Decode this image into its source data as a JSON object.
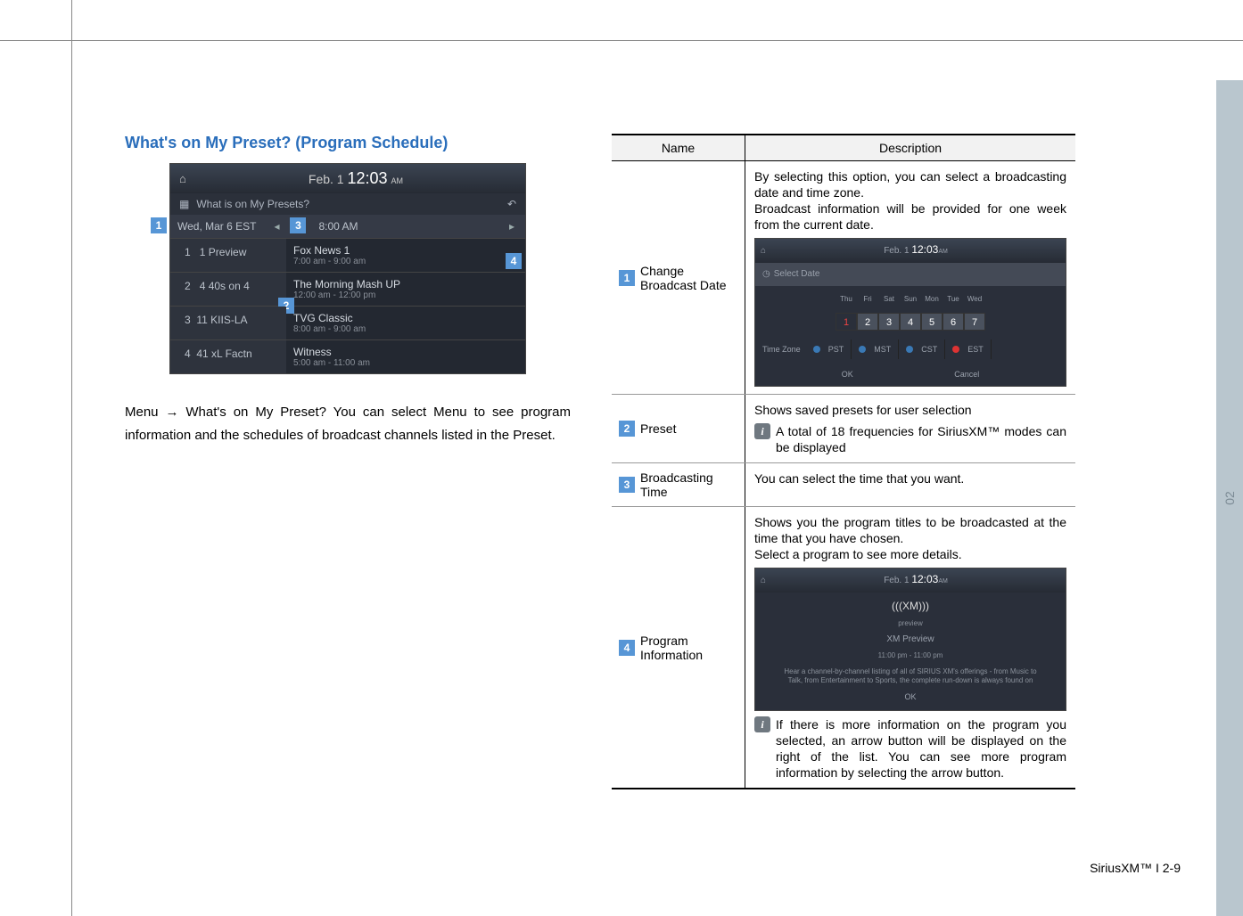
{
  "section_title": "What's on My Preset? (Program Schedule)",
  "main_screenshot": {
    "date_prefix": "Feb.  1",
    "time": "12:03",
    "ampm": "AM",
    "subtitle": "What is on My Presets?",
    "nav_day": "Wed, Mar 6 EST",
    "nav_time": "8:00 AM",
    "rows": [
      {
        "idx": "1",
        "ch": "1 Preview",
        "title": "Fox News 1",
        "slot": "7:00 am - 9:00 am"
      },
      {
        "idx": "2",
        "ch": "4 40s on 4",
        "title": "The Morning Mash UP",
        "slot": "12:00 am - 12:00 pm"
      },
      {
        "idx": "3",
        "ch": "11 KIIS-LA",
        "title": "TVG Classic",
        "slot": "8:00 am - 9:00 am"
      },
      {
        "idx": "4",
        "ch": "41 xL Factn",
        "title": "Witness",
        "slot": "5:00 am - 11:00 am"
      }
    ]
  },
  "body_text_pre": "Menu ",
  "body_text_post": " What's on My Preset? You can select Menu to see pro­gram information and the schedules of broadcast channels listed in the Preset.",
  "table": {
    "headers": {
      "name": "Name",
      "desc": "Description"
    },
    "rows": [
      {
        "num": "1",
        "name": "Change Broadcast Date",
        "desc": "By selecting this option, you can select a broad­casting date and time zone.\nBroadcast information will be provided for one week from the current date.",
        "inner": {
          "date": "Feb.  1",
          "time": "12:03",
          "ampm": "AM",
          "select": "Select Date",
          "days": [
            "Thu",
            "Fri",
            "Sat",
            "Sun",
            "Mon",
            "Tue",
            "Wed"
          ],
          "nums": [
            "1",
            "2",
            "3",
            "4",
            "5",
            "6",
            "7"
          ],
          "tz_label": "Time Zone",
          "tz_opts": [
            "PST",
            "MST",
            "CST",
            "EST"
          ],
          "ok": "OK",
          "cancel": "Cancel"
        }
      },
      {
        "num": "2",
        "name": "Preset",
        "desc": "Shows saved presets for user selection",
        "info_note": "A total of 18 frequencies for SiriusXM™ modes can be displayed"
      },
      {
        "num": "3",
        "name": "Broadcasting Time",
        "desc": "You can select the time that you want."
      },
      {
        "num": "4",
        "name": "Program Information",
        "desc": "Shows you the program titles to be broadcasted at the time that you have chosen.\nSelect a program to see more details.",
        "inner2": {
          "date": "Feb.  1",
          "time": "12:03",
          "ampm": "AM",
          "logo": "(((XM)))",
          "logo_sub": "preview",
          "title": "XM Preview",
          "sub": "11:00 pm - 11:00 pm",
          "desc": "Hear a channel-by-channel listing of all of SIRIUS XM's offerings - from Music to Talk, from Entertainment to Sports, the complete run-down is always found on",
          "ok": "OK"
        },
        "info_note": "If there is more information on the program you selected, an arrow button will be displayed on the right of the list. You can see more program information by selecting the arrow button."
      }
    ]
  },
  "sidebar_label": "02",
  "footer": "SiriusXM™ I 2-9",
  "icons": {
    "home": "⌂",
    "back": "↶",
    "left": "◂",
    "right": "▸",
    "calendar": "▦",
    "arrow": "→",
    "clock": "◷",
    "info": "i"
  }
}
